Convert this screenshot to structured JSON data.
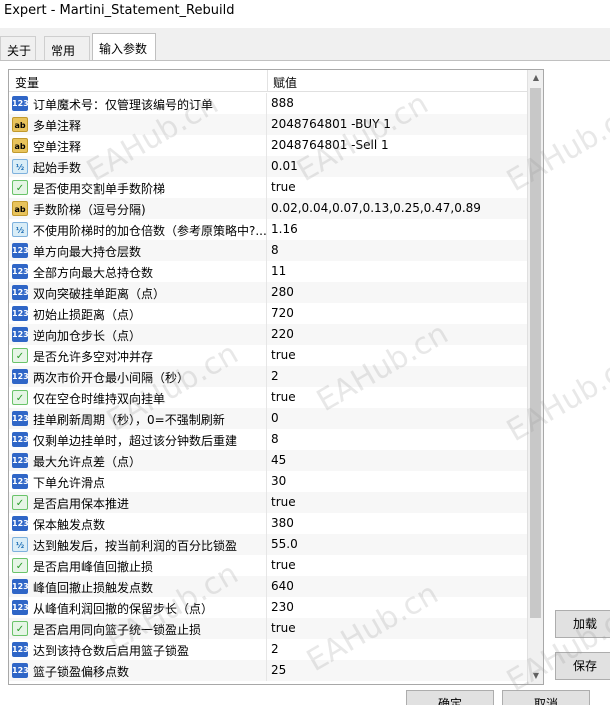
{
  "window": {
    "title": "Expert - Martini_Statement_Rebuild"
  },
  "tabs": [
    {
      "label": "关于"
    },
    {
      "label": "常用"
    },
    {
      "label": "输入参数"
    }
  ],
  "table": {
    "headers": {
      "variable": "变量",
      "value": "赋值"
    },
    "rows": [
      {
        "type": "int",
        "icon": "123",
        "name": "订单魔术号：仅管理该编号的订单",
        "value": "888"
      },
      {
        "type": "str",
        "icon": "ab",
        "name": "多单注释",
        "value": "2048764801 -BUY 1"
      },
      {
        "type": "str",
        "icon": "ab",
        "name": "空单注释",
        "value": "2048764801 -Sell 1"
      },
      {
        "type": "dbl",
        "icon": "½",
        "name": "起始手数",
        "value": "0.01"
      },
      {
        "type": "bool",
        "icon": "✓",
        "name": "是否使用交割单手数阶梯",
        "value": "true"
      },
      {
        "type": "str",
        "icon": "ab",
        "name": "手数阶梯（逗号分隔)",
        "value": "0.02,0.04,0.07,0.13,0.25,0.47,0.89"
      },
      {
        "type": "dbl",
        "icon": "½",
        "name": "不使用阶梯时的加仓倍数（参考原策略中?...",
        "value": "1.16"
      },
      {
        "type": "int",
        "icon": "123",
        "name": "单方向最大持仓层数",
        "value": "8"
      },
      {
        "type": "int",
        "icon": "123",
        "name": "全部方向最大总持仓数",
        "value": "11"
      },
      {
        "type": "int",
        "icon": "123",
        "name": "双向突破挂单距离（点）",
        "value": "280"
      },
      {
        "type": "int",
        "icon": "123",
        "name": "初始止损距离（点）",
        "value": "720"
      },
      {
        "type": "int",
        "icon": "123",
        "name": "逆向加仓步长（点）",
        "value": "220"
      },
      {
        "type": "bool",
        "icon": "✓",
        "name": "是否允许多空对冲并存",
        "value": "true"
      },
      {
        "type": "int",
        "icon": "123",
        "name": "两次市价开仓最小间隔（秒）",
        "value": "2"
      },
      {
        "type": "bool",
        "icon": "✓",
        "name": "仅在空仓时维持双向挂单",
        "value": "true"
      },
      {
        "type": "int",
        "icon": "123",
        "name": "挂单刷新周期（秒），0=不强制刷新",
        "value": "0"
      },
      {
        "type": "int",
        "icon": "123",
        "name": "仅剩单边挂单时，超过该分钟数后重建",
        "value": "8"
      },
      {
        "type": "int",
        "icon": "123",
        "name": "最大允许点差（点）",
        "value": "45"
      },
      {
        "type": "int",
        "icon": "123",
        "name": "下单允许滑点",
        "value": "30"
      },
      {
        "type": "bool",
        "icon": "✓",
        "name": "是否启用保本推进",
        "value": "true"
      },
      {
        "type": "int",
        "icon": "123",
        "name": "保本触发点数",
        "value": "380"
      },
      {
        "type": "dbl",
        "icon": "½",
        "name": "达到触发后，按当前利润的百分比锁盈",
        "value": "55.0"
      },
      {
        "type": "bool",
        "icon": "✓",
        "name": "是否启用峰值回撤止损",
        "value": "true"
      },
      {
        "type": "int",
        "icon": "123",
        "name": "峰值回撤止损触发点数",
        "value": "640"
      },
      {
        "type": "int",
        "icon": "123",
        "name": "从峰值利润回撤的保留步长（点）",
        "value": "230"
      },
      {
        "type": "bool",
        "icon": "✓",
        "name": "是否启用同向篮子统一锁盈止损",
        "value": "true"
      },
      {
        "type": "int",
        "icon": "123",
        "name": "达到该持仓数后启用篮子锁盈",
        "value": "2"
      },
      {
        "type": "int",
        "icon": "123",
        "name": "篮子锁盈偏移点数",
        "value": "25"
      }
    ]
  },
  "buttons": {
    "load": "加载",
    "save": "保存",
    "ok": "确定",
    "cancel": "取消"
  },
  "watermark": "EAHub.cn",
  "colors": {
    "int_icon": "#2f66c7",
    "str_icon": "#e8c35b",
    "dbl_icon": "#d9edf7",
    "bool_icon": "#6ac36a"
  }
}
